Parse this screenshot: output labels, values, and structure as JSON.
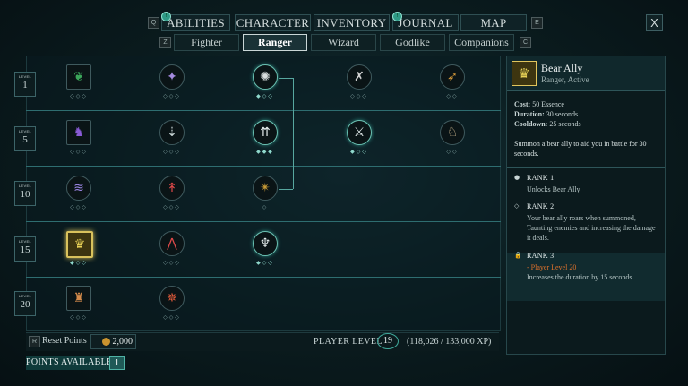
{
  "nav": {
    "prev_key": "Q",
    "next_key": "E",
    "close": "X",
    "tabs": [
      {
        "label": "ABILITIES",
        "badge": "!"
      },
      {
        "label": "CHARACTER"
      },
      {
        "label": "INVENTORY"
      },
      {
        "label": "JOURNAL",
        "badge": "!"
      },
      {
        "label": "MAP"
      }
    ]
  },
  "subnav": {
    "prev_key": "Z",
    "next_key": "C",
    "tabs": [
      {
        "label": "Fighter"
      },
      {
        "label": "Ranger",
        "active": true
      },
      {
        "label": "Wizard"
      },
      {
        "label": "Godlike"
      },
      {
        "label": "Companions"
      }
    ]
  },
  "level_markers": [
    {
      "label": "LEVEL",
      "value": "1"
    },
    {
      "label": "LEVEL",
      "value": "5"
    },
    {
      "label": "LEVEL",
      "value": "10"
    },
    {
      "label": "LEVEL",
      "value": "15"
    },
    {
      "label": "LEVEL",
      "value": "20"
    }
  ],
  "abilities": [
    {
      "row": 0,
      "col": 0,
      "icon": "ranger-emblem-icon",
      "glyph": "❦",
      "color": "#3ba55a",
      "shape": "square",
      "ranks": "◇◇◇"
    },
    {
      "row": 0,
      "col": 1,
      "icon": "orb-sparkle-icon",
      "glyph": "✦",
      "color": "#a58be0",
      "shape": "circle",
      "ranks": "◇◇◇"
    },
    {
      "row": 0,
      "col": 2,
      "icon": "beast-claw-icon",
      "glyph": "✺",
      "color": "#d8dede",
      "shape": "circle",
      "ranks": "◆◇◇",
      "learned": true
    },
    {
      "row": 0,
      "col": 3,
      "icon": "crossed-arrows-icon",
      "glyph": "✗",
      "color": "#d3d3d3",
      "shape": "circle",
      "ranks": "◇◇◇"
    },
    {
      "row": 0,
      "col": 4,
      "icon": "arrow-volley-icon",
      "glyph": "➶",
      "color": "#d79a3a",
      "shape": "circle",
      "ranks": "◇◇"
    },
    {
      "row": 1,
      "col": 0,
      "icon": "shadow-beast-icon",
      "glyph": "♞",
      "color": "#8a5bd6",
      "shape": "square",
      "ranks": "◇◇◇"
    },
    {
      "row": 1,
      "col": 1,
      "icon": "arrow-rain-icon",
      "glyph": "⇣",
      "color": "#c9d6d6",
      "shape": "circle",
      "ranks": "◇◇◇"
    },
    {
      "row": 1,
      "col": 2,
      "icon": "triple-arrow-icon",
      "glyph": "⇈",
      "color": "#e6eeee",
      "shape": "circle",
      "ranks": "◆◆◆",
      "learned": true
    },
    {
      "row": 1,
      "col": 3,
      "icon": "crossed-swords-icon",
      "glyph": "⚔",
      "color": "#e6eeee",
      "shape": "circle",
      "ranks": "◆◇◇",
      "learned": true
    },
    {
      "row": 1,
      "col": 4,
      "icon": "wolf-head-icon",
      "glyph": "♘",
      "color": "#e0c79a",
      "shape": "circle",
      "ranks": "◇◇"
    },
    {
      "row": 2,
      "col": 0,
      "icon": "wind-dash-icon",
      "glyph": "≋",
      "color": "#9d86e6",
      "shape": "circle",
      "ranks": "◇◇◇"
    },
    {
      "row": 2,
      "col": 1,
      "icon": "blood-arrow-icon",
      "glyph": "↟",
      "color": "#e14a4a",
      "shape": "circle",
      "ranks": "◇◇◇"
    },
    {
      "row": 2,
      "col": 2,
      "icon": "hunter-mark-icon",
      "glyph": "✴",
      "color": "#c79a36",
      "shape": "circle",
      "ranks": "◇"
    },
    {
      "row": 3,
      "col": 0,
      "icon": "bear-ally-icon",
      "glyph": "♛",
      "color": "#e8d257",
      "shape": "square",
      "ranks": "◆◇◇",
      "selected": true
    },
    {
      "row": 3,
      "col": 1,
      "icon": "flame-arrow-icon",
      "glyph": "⋀",
      "color": "#e14a4a",
      "shape": "circle",
      "ranks": "◇◇◇"
    },
    {
      "row": 3,
      "col": 2,
      "icon": "hawk-strike-icon",
      "glyph": "♆",
      "color": "#e6eeee",
      "shape": "circle",
      "ranks": "◆◇◇",
      "learned": true
    },
    {
      "row": 4,
      "col": 0,
      "icon": "beast-fury-icon",
      "glyph": "♜",
      "color": "#d48a4a",
      "shape": "square",
      "ranks": "◇◇◇"
    },
    {
      "row": 4,
      "col": 1,
      "icon": "starburst-arrow-icon",
      "glyph": "✵",
      "color": "#e05a3a",
      "shape": "circle",
      "ranks": "◇◇◇"
    }
  ],
  "footer": {
    "reset_key": "R",
    "reset_label": "Reset Points",
    "reset_cost": "2,000",
    "player_level_label": "PLAYER LEVEL",
    "player_level": "19",
    "xp": "(118,026 / 133,000 XP)",
    "points_label": "POINTS AVAILABLE",
    "points": "1"
  },
  "detail": {
    "name": "Bear Ally",
    "subtitle": "Ranger, Active",
    "cost_label": "Cost:",
    "cost": "50 Essence",
    "duration_label": "Duration:",
    "duration": "30 seconds",
    "cooldown_label": "Cooldown:",
    "cooldown": "25 seconds",
    "description": "Summon a bear ally to aid you in battle for 30 seconds.",
    "ranks": [
      {
        "title": "RANK 1",
        "marker": "●",
        "body": "Unlocks Bear Ally"
      },
      {
        "title": "RANK 2",
        "marker": "◇",
        "body": "Your bear ally roars when summoned, Taunting enemies and increasing the damage it deals."
      },
      {
        "title": "RANK 3",
        "marker": "🔒",
        "requirement": "- Player Level 20",
        "body": "Increases the duration by 15 seconds."
      }
    ]
  },
  "colors": {
    "accent": "#3fa89a",
    "selected": "#d9c25c",
    "locked_req": "#e0722c"
  }
}
